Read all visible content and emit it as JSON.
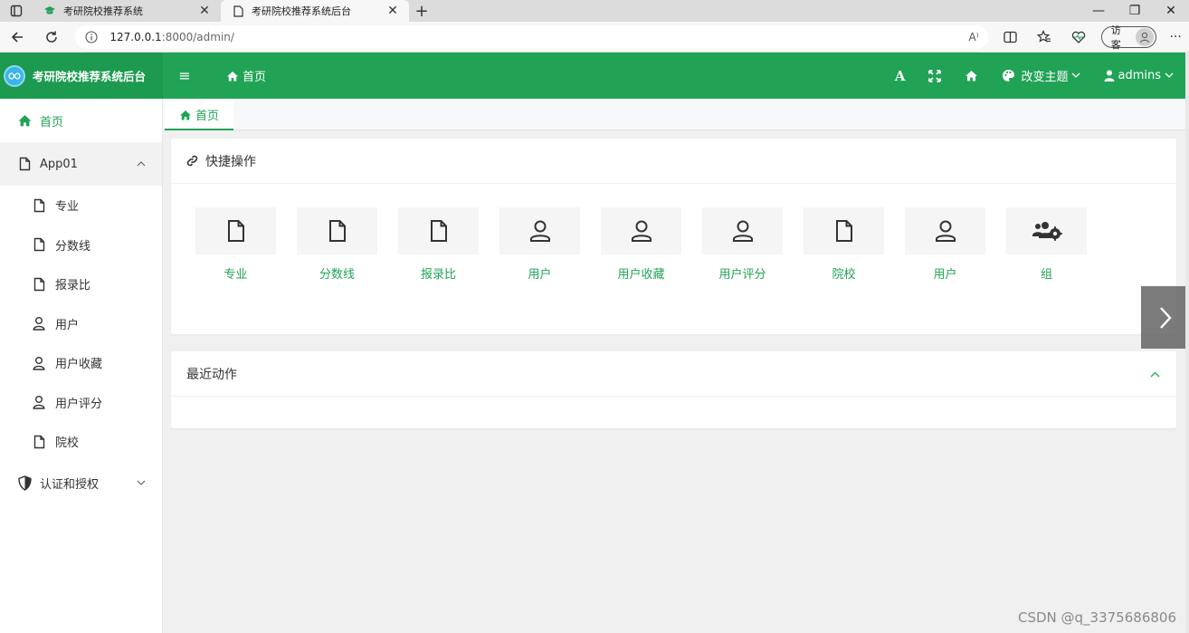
{
  "browser": {
    "tabs": [
      {
        "title": "考研院校推荐系统",
        "active": false
      },
      {
        "title": "考研院校推荐系统后台",
        "active": true
      }
    ],
    "new_tab": "+",
    "url_host": "127.0.0.1",
    "url_rest": ":8000/admin/",
    "read_aloud": "A⁾",
    "guest_label": "访客",
    "more": "···",
    "window_minimize": "—",
    "window_restore": "❐",
    "window_close": "✕"
  },
  "header": {
    "brand_title": "考研院校推荐系统后台",
    "menu_icon": "≡",
    "home_label": "首页",
    "font_label": "A",
    "theme_label": "改变主题",
    "user_label": "admins",
    "accent_color": "#21a356"
  },
  "sidebar": {
    "home": "首页",
    "app_group": "App01",
    "app_items": [
      "专业",
      "分数线",
      "报录比",
      "用户",
      "用户收藏",
      "用户评分",
      "院校"
    ],
    "auth_group": "认证和授权"
  },
  "content_tab": {
    "label": "首页"
  },
  "quick": {
    "title": "快捷操作",
    "items": [
      {
        "label": "专业",
        "icon": "file-icon"
      },
      {
        "label": "分数线",
        "icon": "file-icon"
      },
      {
        "label": "报录比",
        "icon": "file-icon"
      },
      {
        "label": "用户",
        "icon": "user-icon"
      },
      {
        "label": "用户收藏",
        "icon": "user-icon"
      },
      {
        "label": "用户评分",
        "icon": "user-icon"
      },
      {
        "label": "院校",
        "icon": "file-icon"
      },
      {
        "label": "用户",
        "icon": "user-icon"
      },
      {
        "label": "组",
        "icon": "users-cog-icon"
      }
    ]
  },
  "recent": {
    "title": "最近动作"
  },
  "watermark": "CSDN @q_3375686806"
}
